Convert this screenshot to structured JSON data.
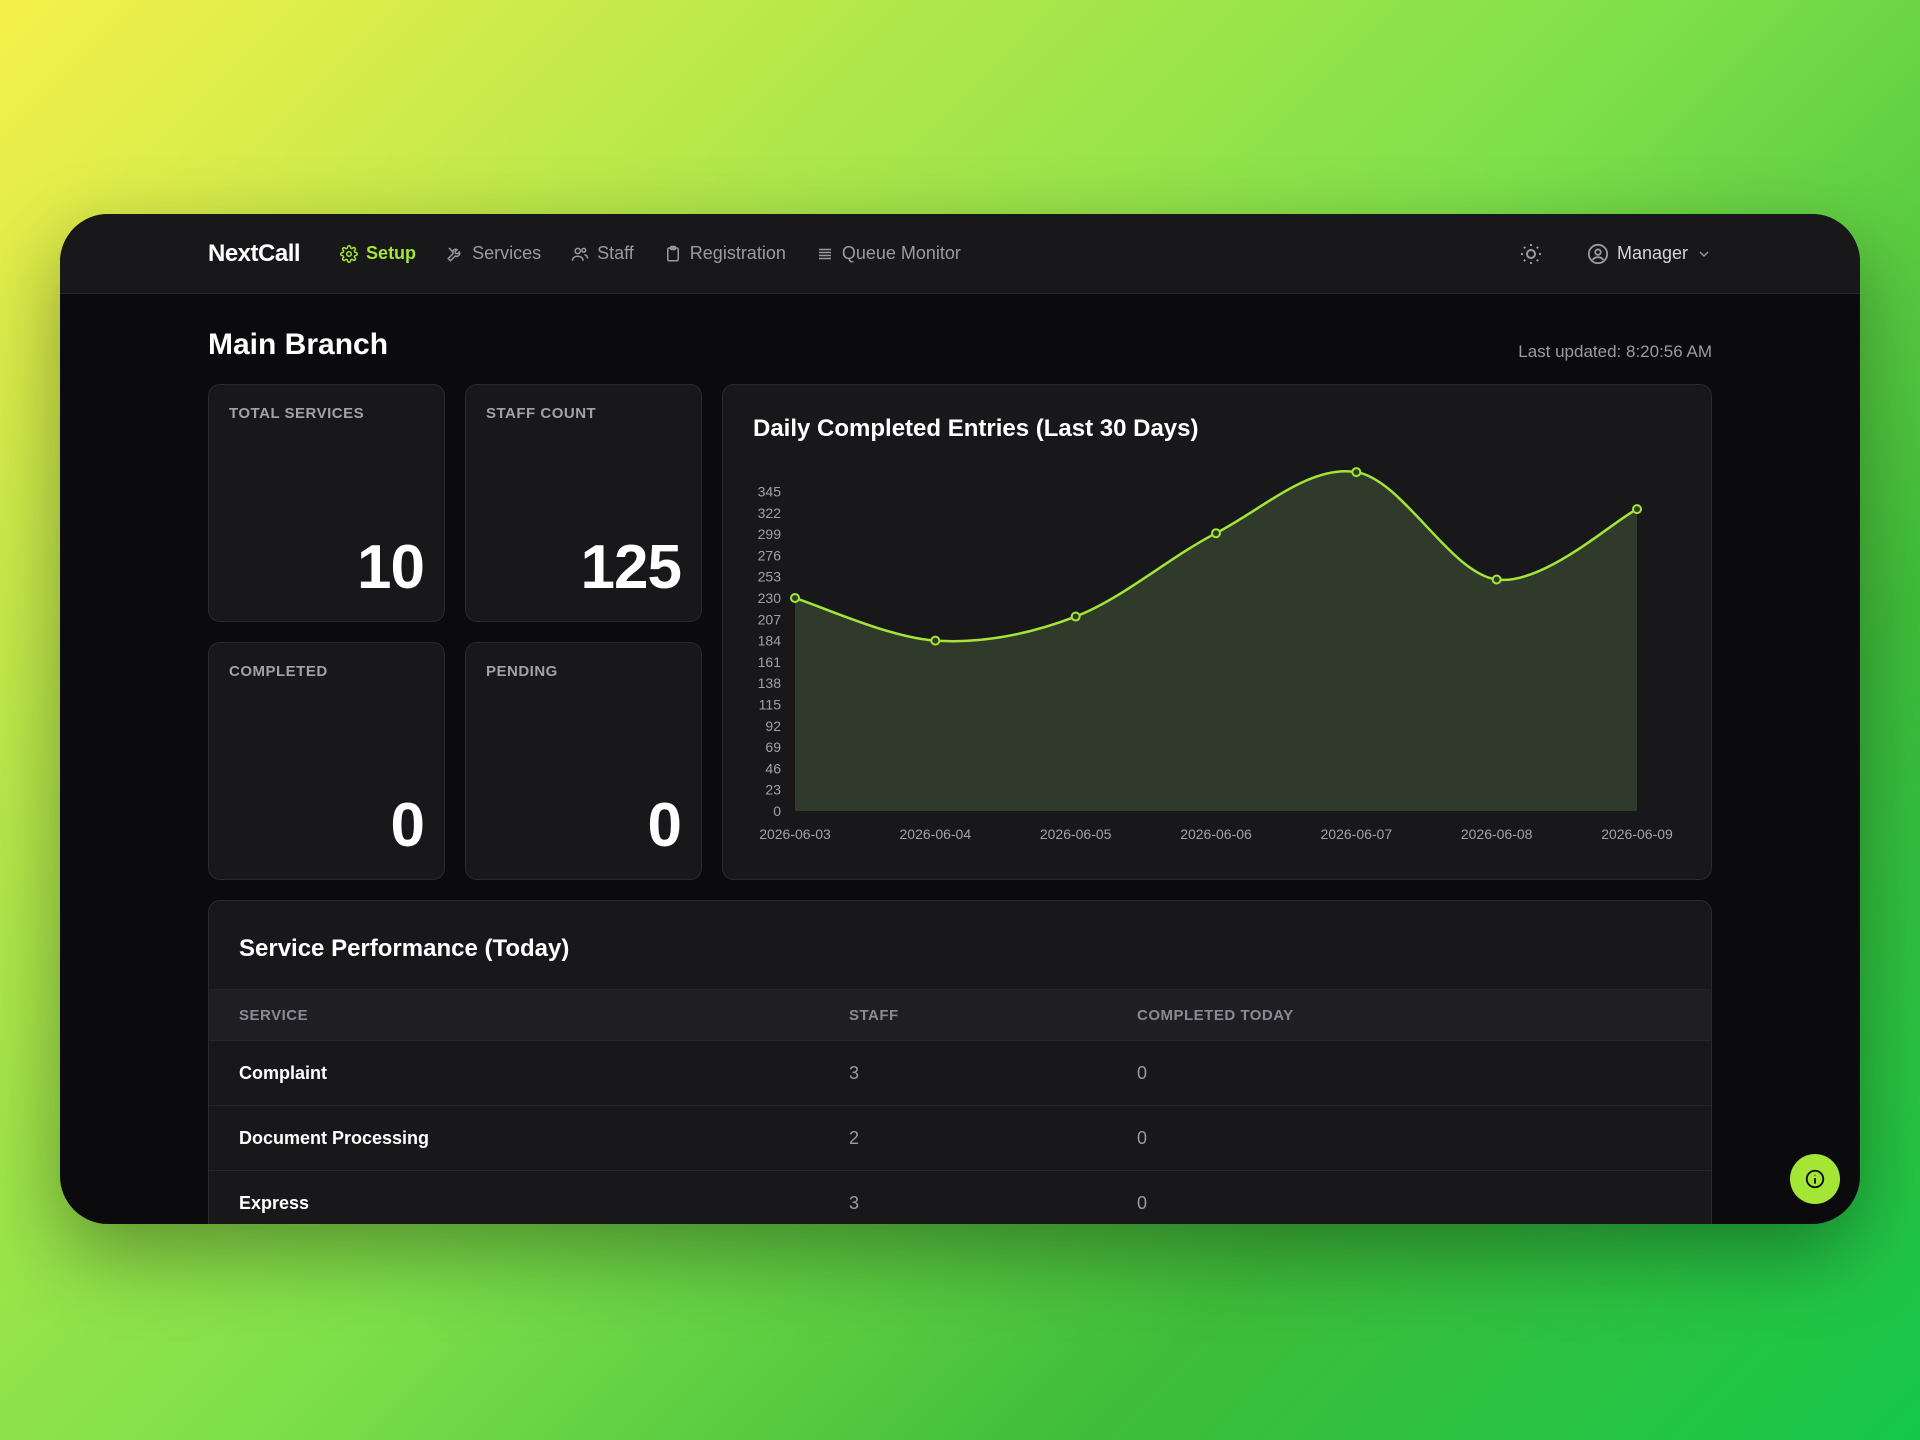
{
  "navbar": {
    "brand": "NextCall",
    "items": [
      {
        "label": "Setup",
        "icon": "gear-icon",
        "active": true
      },
      {
        "label": "Services",
        "icon": "tools-icon",
        "active": false
      },
      {
        "label": "Staff",
        "icon": "users-icon",
        "active": false
      },
      {
        "label": "Registration",
        "icon": "clipboard-icon",
        "active": false
      },
      {
        "label": "Queue Monitor",
        "icon": "list-icon",
        "active": false
      }
    ],
    "theme_icon": "sun-icon",
    "user_label": "Manager"
  },
  "header": {
    "title": "Main Branch",
    "last_updated": "Last updated: 8:20:56 AM"
  },
  "stats": {
    "total_services": {
      "label": "TOTAL SERVICES",
      "value": "10"
    },
    "staff_count": {
      "label": "STAFF COUNT",
      "value": "125"
    },
    "completed": {
      "label": "COMPLETED",
      "value": "0"
    },
    "pending": {
      "label": "PENDING",
      "value": "0"
    }
  },
  "chart_data": {
    "type": "area",
    "title": "Daily Completed Entries (Last 30 Days)",
    "x": [
      "2026-06-03",
      "2026-06-04",
      "2026-06-05",
      "2026-06-06",
      "2026-06-07",
      "2026-06-08",
      "2026-06-09"
    ],
    "values": [
      230,
      184,
      210,
      300,
      366,
      250,
      326
    ],
    "yticks": [
      0,
      23,
      46,
      69,
      92,
      115,
      138,
      161,
      184,
      207,
      230,
      253,
      276,
      299,
      322,
      345
    ],
    "ylim": [
      0,
      365
    ],
    "grid": false,
    "line_color": "#a3e635",
    "fill_color": "#2f3a2a"
  },
  "table": {
    "title": "Service Performance (Today)",
    "headers": {
      "service": "SERVICE",
      "staff": "STAFF",
      "completed": "COMPLETED TODAY"
    },
    "rows": [
      {
        "service": "Complaint",
        "staff": "3",
        "completed": "0"
      },
      {
        "service": "Document Processing",
        "staff": "2",
        "completed": "0"
      },
      {
        "service": "Express",
        "staff": "3",
        "completed": "0"
      }
    ]
  },
  "fab": {
    "icon": "info-icon"
  },
  "colors": {
    "accent": "#a3e635",
    "surface": "#18181b",
    "background": "#0b0b0d"
  }
}
